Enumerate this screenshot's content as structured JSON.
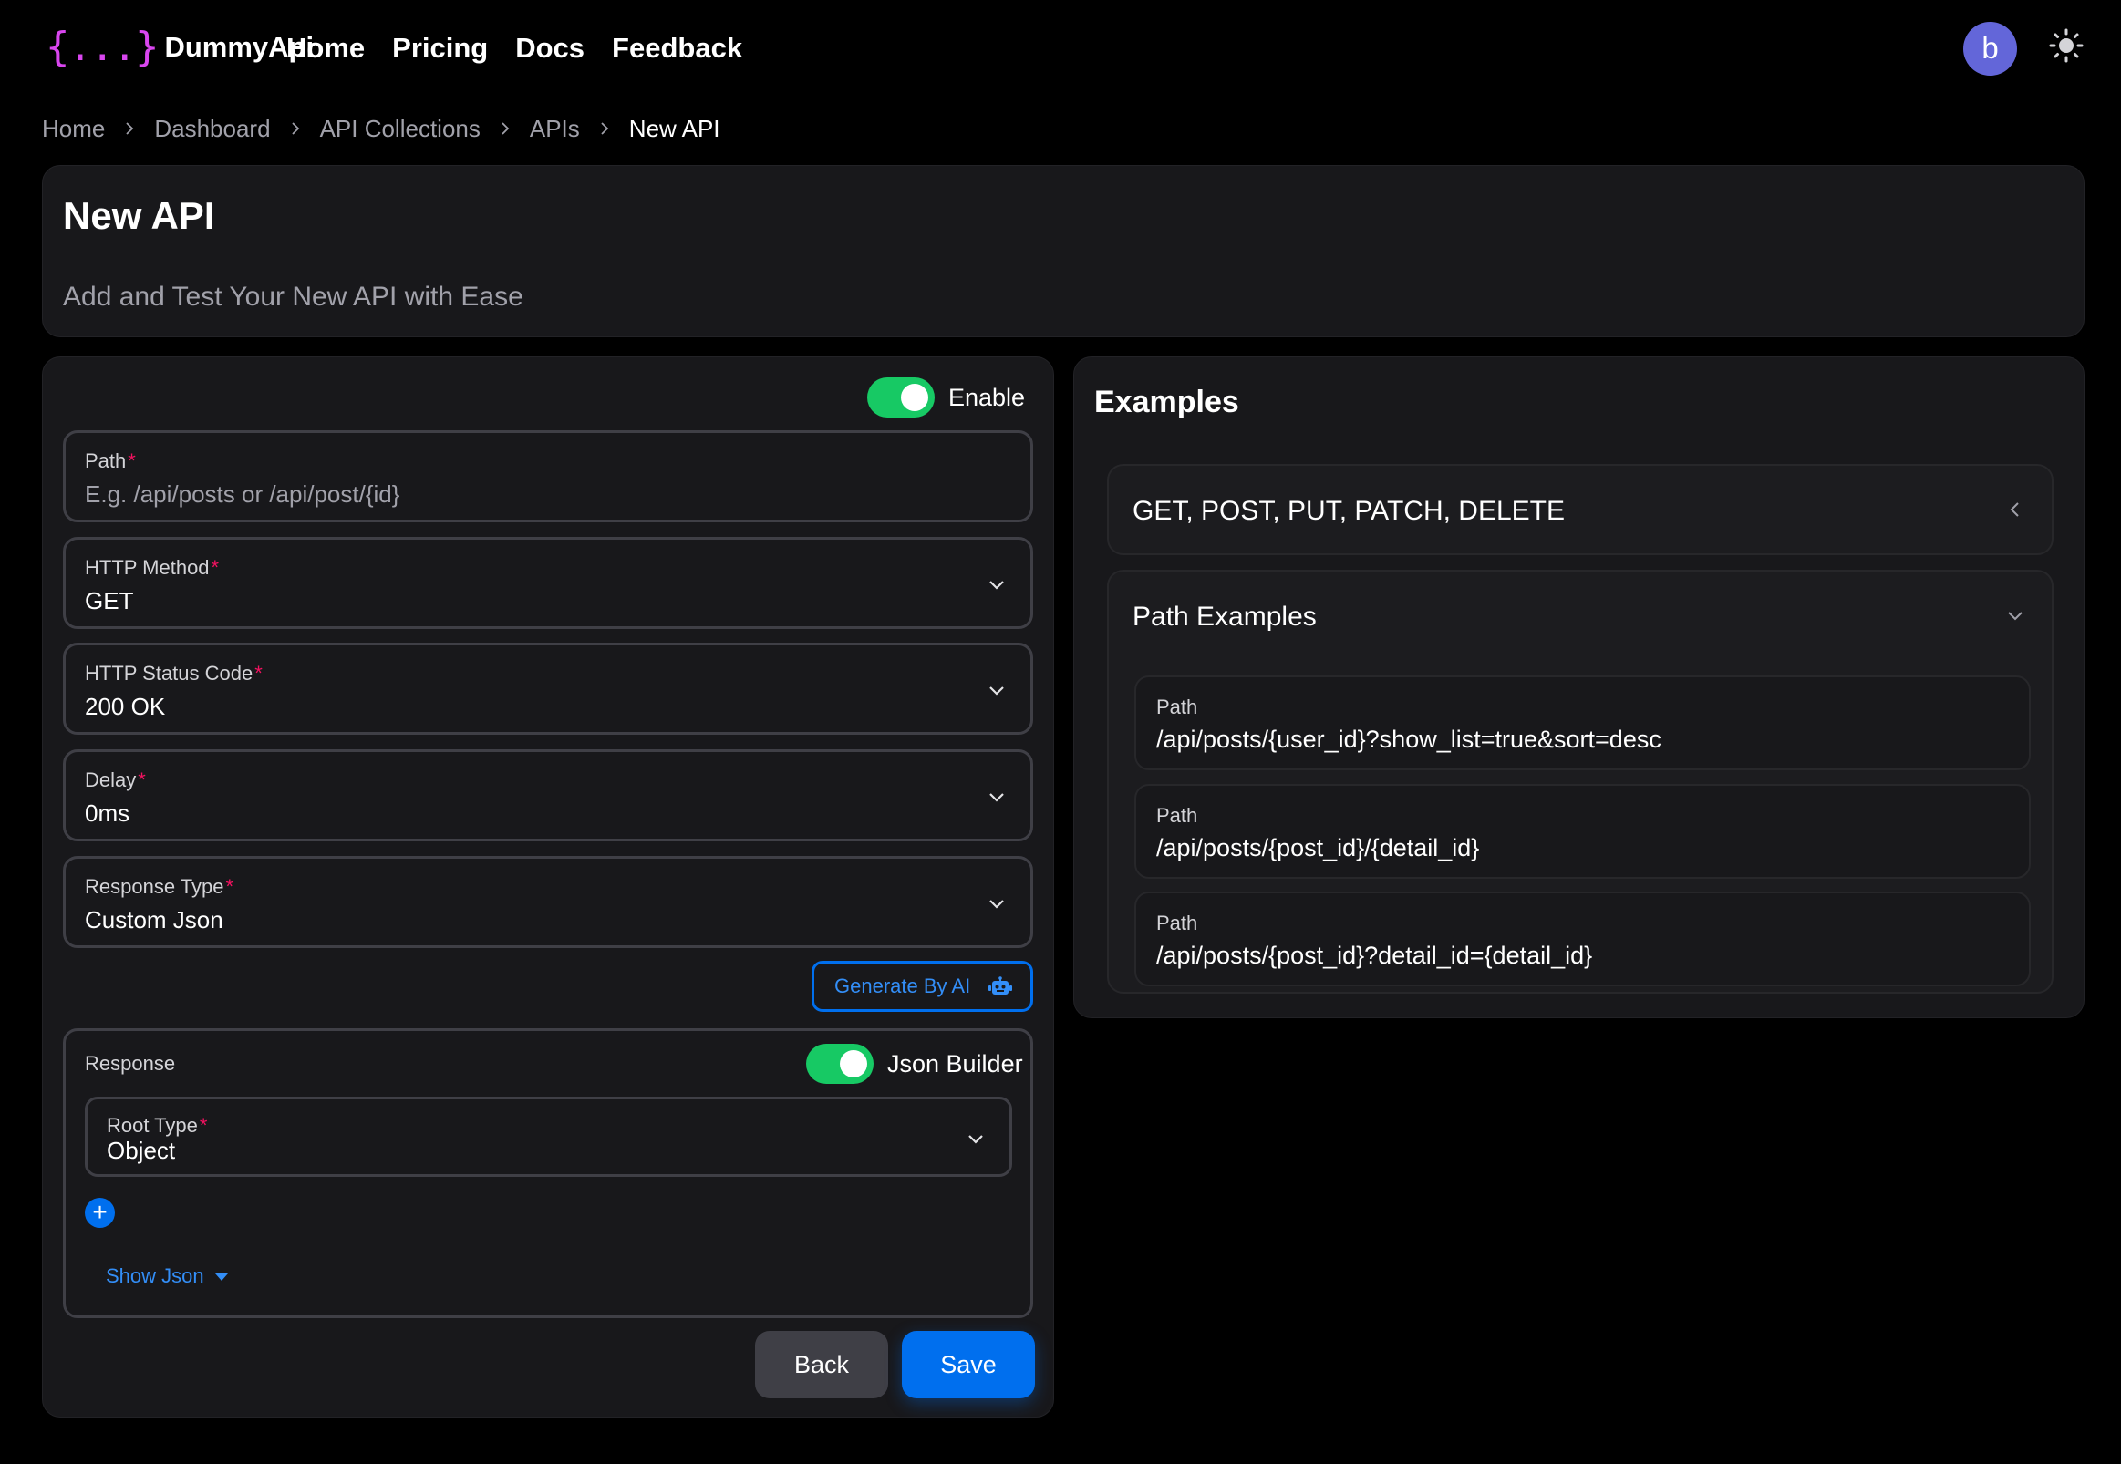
{
  "navbar": {
    "logo_mark": "{...}",
    "logo_text": "DummyApi",
    "links": [
      "Home",
      "Pricing",
      "Docs",
      "Feedback"
    ],
    "avatar_initial": "b"
  },
  "breadcrumb": [
    "Home",
    "Dashboard",
    "API Collections",
    "APIs",
    "New API"
  ],
  "header": {
    "title": "New API",
    "subtitle": "Add and Test Your New API with Ease"
  },
  "form": {
    "enable_label": "Enable",
    "enable_on": true,
    "path": {
      "label": "Path",
      "placeholder": "E.g. /api/posts or /api/post/{id}"
    },
    "http_method": {
      "label": "HTTP Method",
      "value": "GET"
    },
    "http_status": {
      "label": "HTTP Status Code",
      "value": "200 OK"
    },
    "delay": {
      "label": "Delay",
      "value": "0ms"
    },
    "response_type": {
      "label": "Response Type",
      "value": "Custom Json"
    },
    "required_mark": "*",
    "generate_ai_label": "Generate By AI",
    "response": {
      "label": "Response",
      "json_builder_label": "Json Builder",
      "json_builder_on": true,
      "root_type": {
        "label": "Root Type",
        "value": "Object"
      },
      "add_symbol": "+",
      "show_json_label": "Show Json"
    },
    "back_label": "Back",
    "save_label": "Save"
  },
  "examples": {
    "title": "Examples",
    "methods_heading": "GET, POST, PUT, PATCH, DELETE",
    "path_heading": "Path Examples",
    "items": [
      {
        "label": "Path",
        "value": "/api/posts/{user_id}?show_list=true&sort=desc"
      },
      {
        "label": "Path",
        "value": "/api/posts/{post_id}/{detail_id}"
      },
      {
        "label": "Path",
        "value": "/api/posts/{post_id}?detail_id={detail_id}"
      }
    ]
  },
  "colors": {
    "background": "#000000",
    "card": "#18181b",
    "accent_blue": "#006fee",
    "toggle_green": "#17c964",
    "logo_magenta": "#d946ef",
    "required_red": "#f31260",
    "avatar": "#6366d9"
  }
}
